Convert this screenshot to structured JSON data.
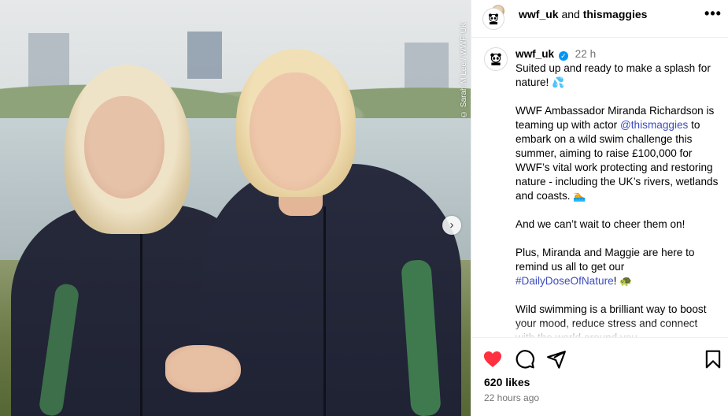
{
  "photo": {
    "credit": "© Sarah M Lee / WWF-UK",
    "next_icon": "›"
  },
  "header": {
    "user1": "wwf_uk",
    "joiner": " and ",
    "user2": "thismaggies",
    "more_icon": "•••"
  },
  "caption": {
    "username": "wwf_uk",
    "verified_icon": "✓",
    "time": "22 h",
    "p1": "Suited up and ready to make a splash for nature!",
    "p1_emoji": "💦",
    "p2_a": "WWF Ambassador Miranda Richardson is teaming up with actor ",
    "p2_mention": "@thismaggies",
    "p2_b": " to embark on a wild swim challenge this summer, aiming to raise £100,000 for WWF’s vital work protecting and restoring nature - including the UK’s rivers, wetlands and coasts.",
    "p2_emoji": "🏊",
    "p3": "And we can’t wait to cheer them on!",
    "p4_a": "Plus, Miranda and Maggie are here to remind us all to get our ",
    "p4_hashtag": "#DailyDoseOfNature",
    "p4_b": "!",
    "p4_emoji": "🐢",
    "p5": "Wild swimming is a brilliant way to boost your mood, reduce stress and connect with the world around you."
  },
  "actions": {
    "like_icon": "heart-filled-icon",
    "comment_icon": "comment-icon",
    "share_icon": "share-icon",
    "save_icon": "bookmark-icon",
    "like_color": "#ff3040"
  },
  "stats": {
    "likes": "620 likes",
    "time_ago": "22 hours ago"
  }
}
